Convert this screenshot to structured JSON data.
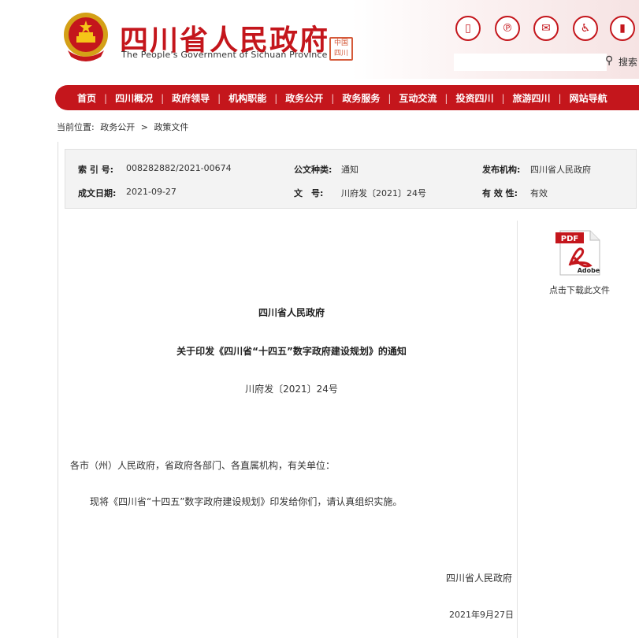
{
  "header": {
    "title": "四川省人民政府",
    "subtitle": "The People's Government of Sichuan Province",
    "emblem_icon": "national-emblem-icon",
    "seal_text": "中国四川",
    "tools": [
      {
        "name": "mobile-icon",
        "glyph": "▯"
      },
      {
        "name": "weibo-icon",
        "glyph": "℗"
      },
      {
        "name": "message-icon",
        "glyph": "✉"
      },
      {
        "name": "accessibility-icon",
        "glyph": "♿"
      },
      {
        "name": "elder-mode-icon",
        "glyph": "▮"
      }
    ],
    "search": {
      "placeholder": "",
      "label": "搜索"
    }
  },
  "nav": {
    "items": [
      "首页",
      "四川概况",
      "政府领导",
      "机构职能",
      "政务公开",
      "政务服务",
      "互动交流",
      "投资四川",
      "旅游四川",
      "网站导航"
    ],
    "separator": "|"
  },
  "breadcrumb": {
    "label": "当前位置:",
    "items": [
      "政务公开",
      ">",
      "政策文件"
    ]
  },
  "meta": {
    "index_label": "索 引 号:",
    "index_value": "008282882/2021-00674",
    "type_label": "公文种类:",
    "type_value": "通知",
    "publisher_label": "发布机构:",
    "publisher_value": "四川省人民政府",
    "date_label": "成文日期:",
    "date_value": "2021-09-27",
    "docno_label": "文　号:",
    "docno_value": "川府发〔2021〕24号",
    "validity_label": "有 效 性:",
    "validity_value": "有效"
  },
  "download": {
    "pdf_badge": "PDF",
    "adobe_text": "Adobe",
    "label": "点击下载此文件"
  },
  "document": {
    "org": "四川省人民政府",
    "title": "关于印发《四川省“十四五”数字政府建设规划》的通知",
    "number": "川府发〔2021〕24号",
    "recipients": "各市（州）人民政府，省政府各部门、各直属机构，有关单位：",
    "body": "现将《四川省“十四五”数字政府建设规划》印发给你们，请认真组织实施。",
    "signature": "四川省人民政府",
    "date": "2021年9月27日"
  },
  "colors": {
    "brand_red": "#c4161c",
    "meta_bg": "#f3f3f3"
  }
}
